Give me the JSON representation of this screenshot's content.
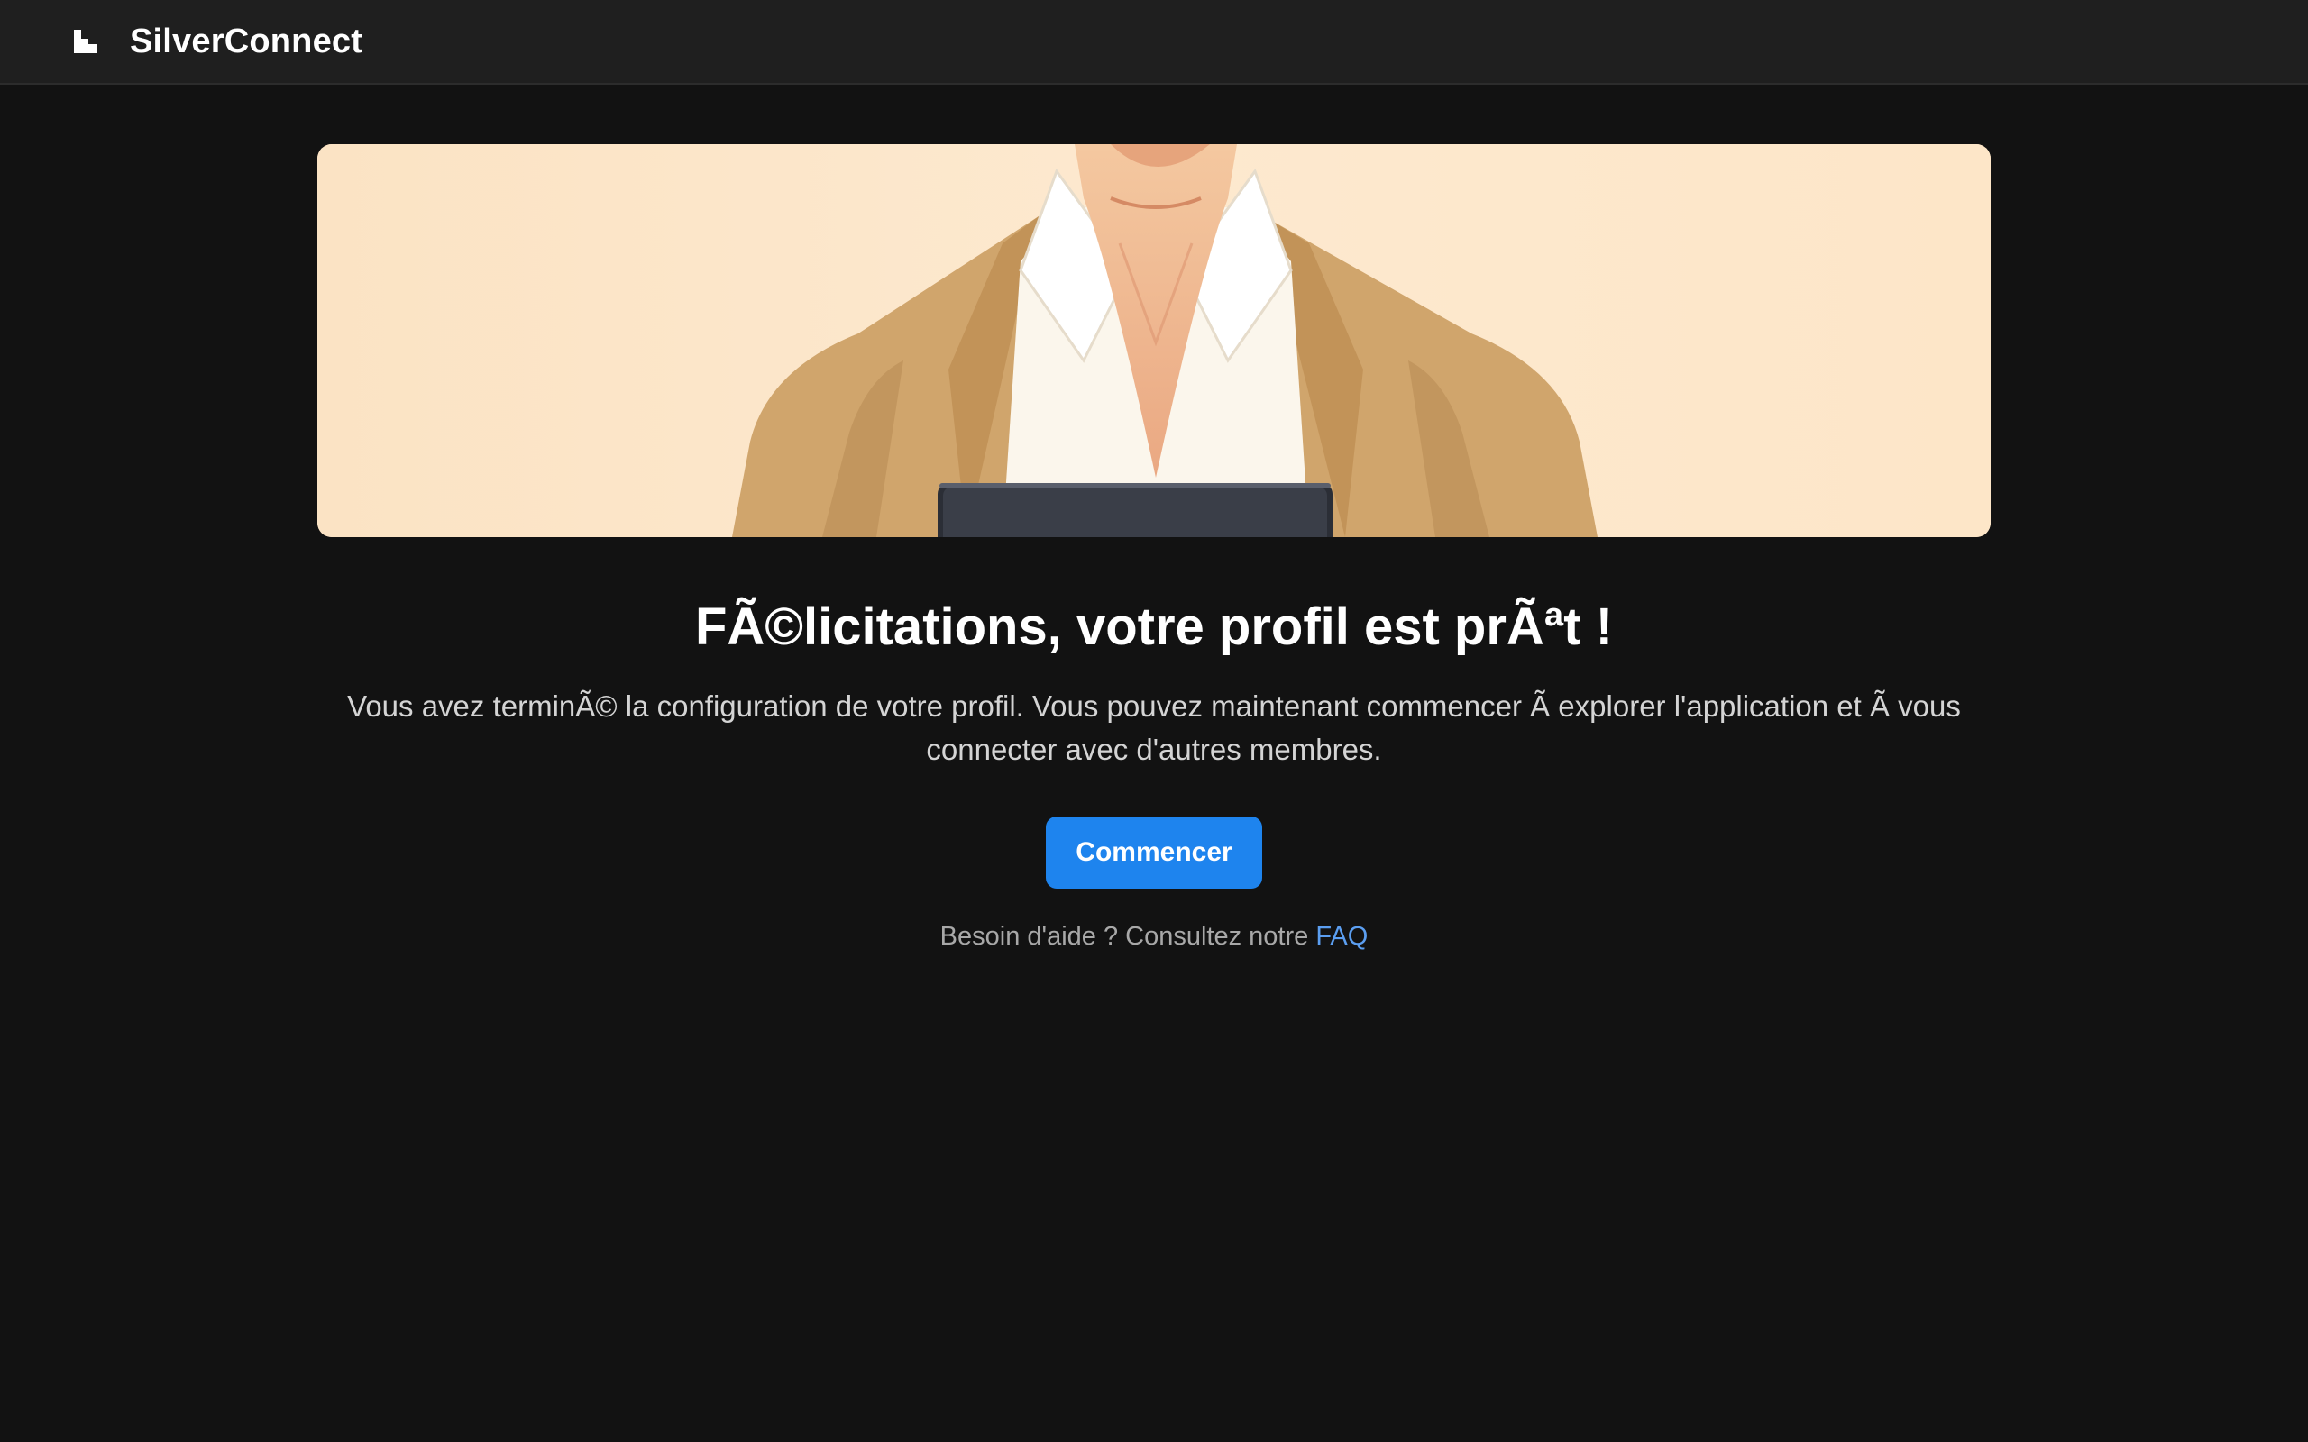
{
  "header": {
    "app_name": "SilverConnect",
    "logo_icon": "silverconnect-logo-icon"
  },
  "hero": {
    "image": "illustration of a person in a tan cardigan and white shirt holding a tablet"
  },
  "main": {
    "title": "FÃ©licitations, votre profil est prÃªt !",
    "description": "Vous avez terminÃ© la configuration de votre profil. Vous pouvez maintenant commencer Ã  explorer l'application et Ã  vous connecter avec d'autres membres.",
    "start_button_label": "Commencer",
    "help_text": "Besoin d'aide ? Consultez notre ",
    "help_link_label": "FAQ"
  },
  "colors": {
    "background": "#121212",
    "header_background": "#1f1f1f",
    "accent": "#1e84ee",
    "link": "#5b9ef0"
  }
}
